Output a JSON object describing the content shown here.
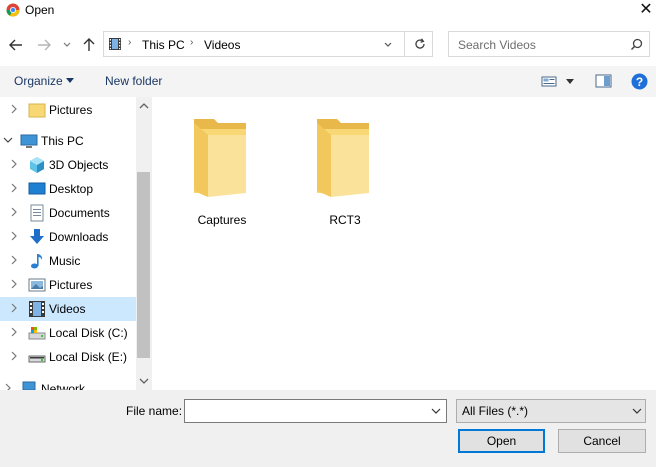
{
  "window": {
    "title": "Open",
    "close_symbol": "✕"
  },
  "address": {
    "crumbs": [
      "This PC",
      "Videos"
    ]
  },
  "search": {
    "placeholder": "Search Videos"
  },
  "toolbar": {
    "organize_label": "Organize",
    "new_folder_label": "New folder"
  },
  "nav": {
    "items": [
      {
        "label": "Pictures",
        "icon": "folder-icon"
      },
      {
        "label": "This PC",
        "icon": "computer-icon"
      },
      {
        "label": "3D Objects",
        "icon": "cube-icon"
      },
      {
        "label": "Desktop",
        "icon": "desktop-icon"
      },
      {
        "label": "Documents",
        "icon": "document-icon"
      },
      {
        "label": "Downloads",
        "icon": "download-arrow-icon"
      },
      {
        "label": "Music",
        "icon": "music-note-icon"
      },
      {
        "label": "Pictures",
        "icon": "pictures-icon"
      },
      {
        "label": "Videos",
        "icon": "film-icon",
        "selected": true
      },
      {
        "label": "Local Disk (C:)",
        "icon": "drive-icon"
      },
      {
        "label": "Local Disk (E:)",
        "icon": "drive-icon"
      },
      {
        "label": "Network",
        "icon": "network-icon"
      }
    ]
  },
  "content": {
    "folders": [
      {
        "name": "Captures"
      },
      {
        "name": "RCT3"
      }
    ]
  },
  "footer": {
    "file_name_label": "File name:",
    "file_name_value": "",
    "file_type": "All Files (*.*)",
    "open_label": "Open",
    "cancel_label": "Cancel"
  },
  "colors": {
    "selection": "#cce8ff",
    "accent": "#0078d7",
    "folder": "#f8d775",
    "help": "#1e6fd9"
  }
}
